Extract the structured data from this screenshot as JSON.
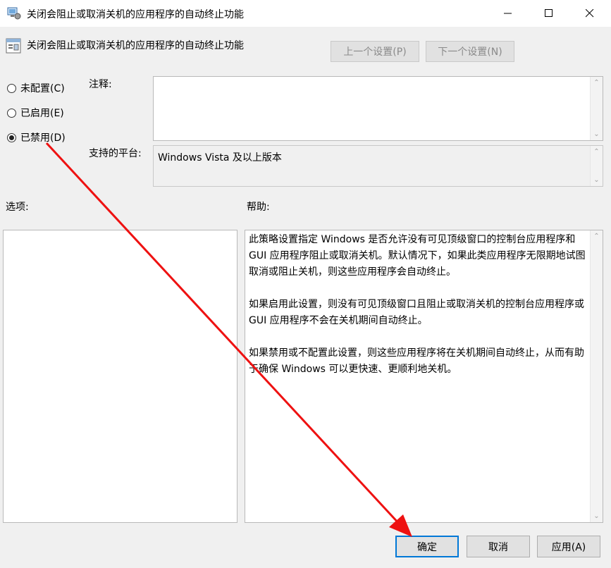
{
  "window": {
    "title": "关闭会阻止或取消关机的应用程序的自动终止功能",
    "icon": "policy-setting-icon"
  },
  "header": {
    "title": "关闭会阻止或取消关机的应用程序的自动终止功能",
    "prev_label": "上一个设置(P)",
    "next_label": "下一个设置(N)"
  },
  "state": {
    "options": [
      {
        "label": "未配置(C)",
        "checked": false
      },
      {
        "label": "已启用(E)",
        "checked": false
      },
      {
        "label": "已禁用(D)",
        "checked": true
      }
    ]
  },
  "comment": {
    "label": "注释:",
    "value": ""
  },
  "platform": {
    "label": "支持的平台:",
    "value": "Windows Vista 及以上版本"
  },
  "options_section": {
    "label": "选项:"
  },
  "help": {
    "label": "帮助:",
    "text": "此策略设置指定 Windows 是否允许没有可见顶级窗口的控制台应用程序和 GUI 应用程序阻止或取消关机。默认情况下，如果此类应用程序无限期地试图取消或阻止关机，则这些应用程序会自动终止。\n\n如果启用此设置，则没有可见顶级窗口且阻止或取消关机的控制台应用程序或 GUI 应用程序不会在关机期间自动终止。\n\n如果禁用或不配置此设置，则这些应用程序将在关机期间自动终止，从而有助于确保 Windows 可以更快速、更顺利地关机。"
  },
  "buttons": {
    "ok": "确定",
    "cancel": "取消",
    "apply": "应用(A)"
  },
  "annotation": {
    "color": "#ee1111"
  }
}
